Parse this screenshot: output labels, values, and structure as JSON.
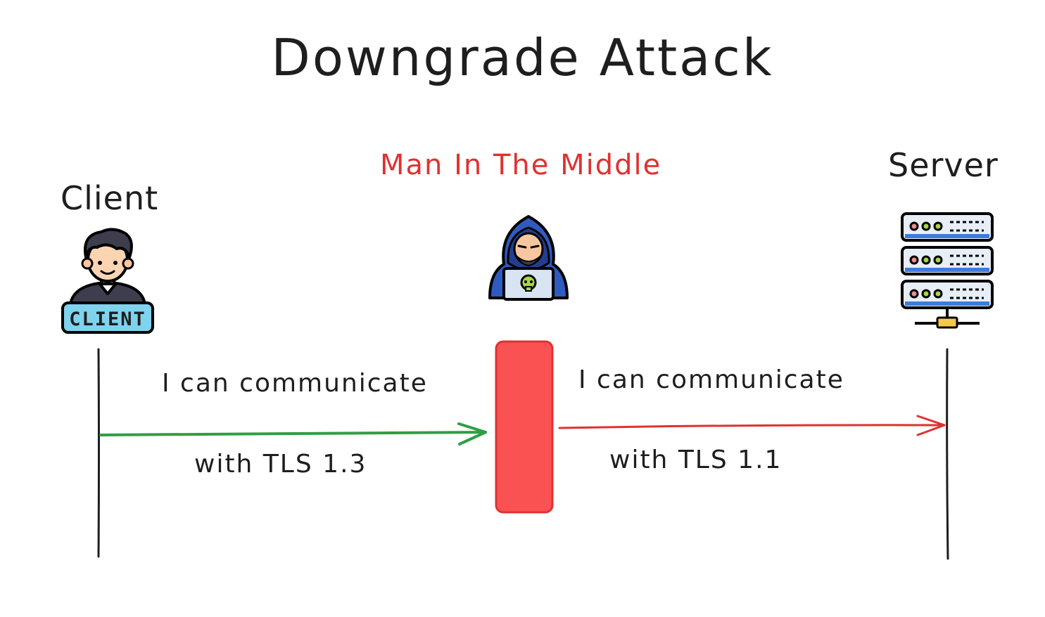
{
  "title": "Downgrade Attack",
  "actors": {
    "client": {
      "label": "Client",
      "badge": "CLIENT",
      "icon": "client-person-icon"
    },
    "mitm": {
      "label": "Man In The Middle",
      "icon": "hacker-icon",
      "color": "#e03131"
    },
    "server": {
      "label": "Server",
      "icon": "server-rack-icon"
    }
  },
  "messages": [
    {
      "from": "client",
      "to": "mitm",
      "line1": "I can communicate",
      "line2": "with TLS 1.3",
      "color": "#2f9e44"
    },
    {
      "from": "mitm",
      "to": "server",
      "line1": "I can communicate",
      "line2": "with TLS 1.1",
      "color": "#e03131"
    }
  ],
  "colors": {
    "interceptor_box": "#fa5252",
    "lifeline": "#1e1e1e"
  }
}
